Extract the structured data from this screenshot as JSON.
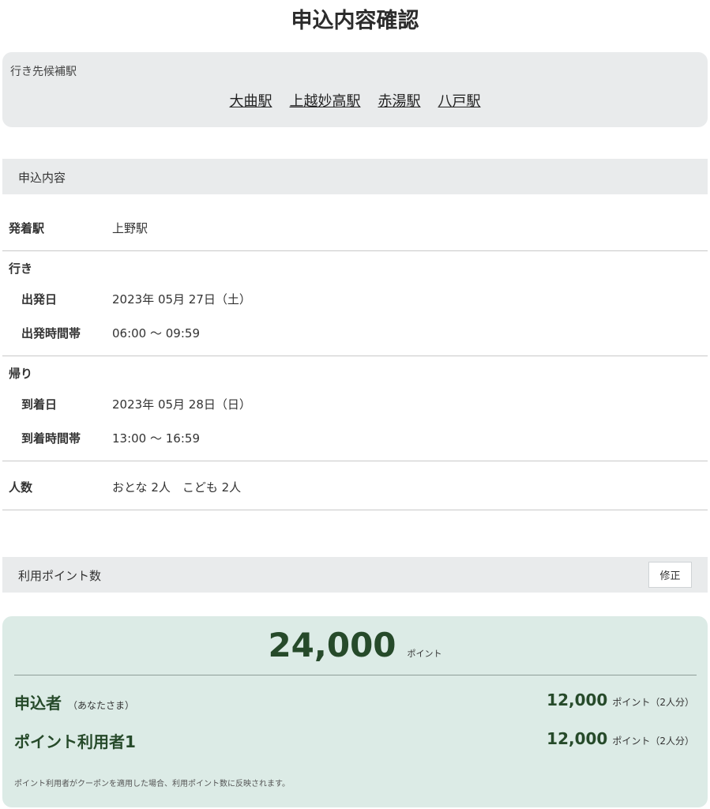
{
  "page": {
    "title": "申込内容確認"
  },
  "candidates": {
    "label": "行き先候補駅",
    "stations": [
      "大曲駅",
      "上越妙高駅",
      "赤湯駅",
      "八戸駅"
    ]
  },
  "application": {
    "header": "申込内容",
    "departure_station": {
      "label": "発着駅",
      "value": "上野駅"
    },
    "outbound": {
      "label": "行き",
      "date": {
        "label": "出発日",
        "value": "2023年 05月 27日（土）"
      },
      "time": {
        "label": "出発時間帯",
        "value": "06:00 〜 09:59"
      }
    },
    "return": {
      "label": "帰り",
      "date": {
        "label": "到着日",
        "value": "2023年 05月 28日（日）"
      },
      "time": {
        "label": "到着時間帯",
        "value": "13:00 〜 16:59"
      }
    },
    "people": {
      "label": "人数",
      "value": "おとな 2人　こども 2人"
    }
  },
  "points": {
    "header": "利用ポイント数",
    "edit_label": "修正",
    "total": "24,000",
    "total_unit": "ポイント",
    "users": [
      {
        "name": "申込者",
        "note": "（あなたさま）",
        "points": "12,000",
        "unit": "ポイント（2人分）"
      },
      {
        "name": "ポイント利用者1",
        "note": "",
        "points": "12,000",
        "unit": "ポイント（2人分）"
      }
    ],
    "note": "ポイント利用者がクーポンを適用した場合、利用ポイント数に反映されます。"
  },
  "colors": {
    "accent": "#264a2a",
    "panel": "#e9ebec",
    "points_bg": "#dcebe6"
  }
}
